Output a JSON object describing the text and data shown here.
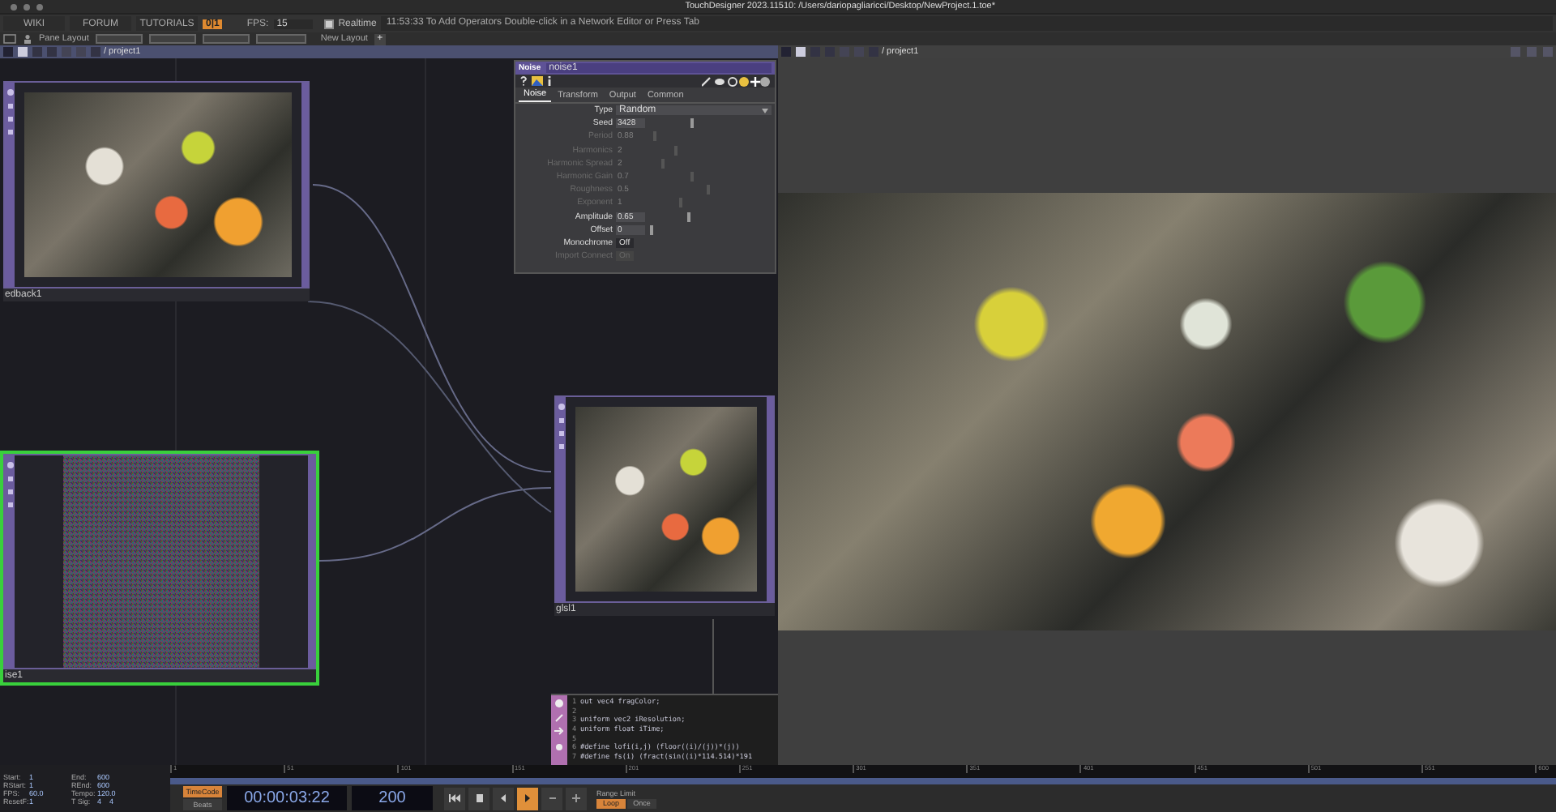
{
  "window": {
    "title": "TouchDesigner 2023.11510: /Users/dariopagliaricci/Desktop/NewProject.1.toe*"
  },
  "menu_bar": {
    "links": [
      "WIKI",
      "FORUM",
      "TUTORIALS"
    ],
    "counter": "0|1",
    "fps_label": "FPS:",
    "fps": "15",
    "realtime": {
      "label": "Realtime",
      "checked": true
    },
    "message": "11:53:33 To Add Operators Double-click in a Network Editor or Press Tab"
  },
  "layout_bar": {
    "pane_layout": "Pane Layout",
    "new_layout": "New Layout",
    "add": "+"
  },
  "left_pane": {
    "path": "/ project1",
    "nodes": [
      {
        "label": "edback1",
        "kind": "render",
        "selected": false
      },
      {
        "label": "ise1",
        "kind": "noise",
        "selected": true
      },
      {
        "label": "glsl1",
        "kind": "render",
        "selected": false
      }
    ],
    "params": {
      "op_type": "Noise",
      "name": "noise1",
      "tabs": [
        {
          "label": "Noise",
          "selected": true
        },
        {
          "label": "Transform",
          "selected": false
        },
        {
          "label": "Output",
          "selected": false
        },
        {
          "label": "Common",
          "selected": false
        }
      ],
      "rows": [
        {
          "label": "Type",
          "kind": "menu",
          "value": "Random",
          "disabled": false
        },
        {
          "label": "Seed",
          "kind": "slider",
          "value": "3428",
          "level": 0.35,
          "disabled": false
        },
        {
          "label": "Period",
          "kind": "slider",
          "value": "0.88",
          "level": 0.04,
          "disabled": true
        },
        {
          "label": "Harmonics",
          "kind": "slider",
          "value": "2",
          "level": 0.21,
          "disabled": true
        },
        {
          "label": "Harmonic Spread",
          "kind": "slider",
          "value": "2",
          "level": 0.11,
          "disabled": true
        },
        {
          "label": "Harmonic Gain",
          "kind": "slider",
          "value": "0.7",
          "level": 0.35,
          "disabled": true
        },
        {
          "label": "Roughness",
          "kind": "slider",
          "value": "0.5",
          "level": 0.49,
          "disabled": true
        },
        {
          "label": "Exponent",
          "kind": "slider",
          "value": "1",
          "level": 0.26,
          "disabled": true
        },
        {
          "label": "Amplitude",
          "kind": "slider",
          "value": "0.65",
          "level": 0.32,
          "disabled": false
        },
        {
          "label": "Offset",
          "kind": "slider",
          "value": "0",
          "level": 0.02,
          "disabled": false
        },
        {
          "label": "Monochrome",
          "kind": "toggle",
          "value": "Off",
          "disabled": false
        },
        {
          "label": "Import Connect",
          "kind": "toggle",
          "value": "On",
          "disabled": true
        }
      ]
    },
    "code": {
      "lines": [
        {
          "number": "1",
          "text": "out vec4 fragColor;"
        },
        {
          "number": "2"
        },
        {
          "number": "3",
          "text": "uniform vec2 iResolution;"
        },
        {
          "number": "4",
          "text": "uniform float iTime;"
        },
        {
          "number": "5"
        },
        {
          "number": "6",
          "text": "#define lofi(i,j) (floor((i)/(j))*(j))"
        },
        {
          "number": "7",
          "text": "#define fs(i) (fract(sin((i)*114.514)*191"
        }
      ]
    }
  },
  "right_pane": {
    "path": "/ project1"
  },
  "timeline": {
    "fields": [
      {
        "label": "Start:",
        "value": "1"
      },
      {
        "label": "End:",
        "value": "600"
      },
      {
        "label": "RStart:",
        "value": "1"
      },
      {
        "label": "REnd:",
        "value": "600"
      },
      {
        "label": "FPS:",
        "value": "60.0"
      },
      {
        "label": "Tempo:",
        "value": "120.0"
      },
      {
        "label": "ResetF:",
        "value": "1"
      },
      {
        "label": "T Sig:",
        "value": "4    4"
      }
    ],
    "ruler": [
      "1",
      "51",
      "101",
      "151",
      "201",
      "251",
      "301",
      "351",
      "401",
      "451",
      "501",
      "551",
      "600"
    ],
    "time_modes": [
      {
        "label": "TimeCode",
        "selected": true
      },
      {
        "label": "Beats",
        "selected": false
      }
    ],
    "timecode": "00:00:03:22",
    "frame": "200",
    "transport": [
      {
        "kind": "start",
        "selected": false
      },
      {
        "kind": "stop",
        "selected": false
      },
      {
        "kind": "reverse",
        "selected": false
      },
      {
        "kind": "play",
        "selected": true
      },
      {
        "kind": "step-back",
        "selected": false
      },
      {
        "kind": "step-forward",
        "selected": false
      }
    ],
    "range_limit": {
      "label": "Range Limit",
      "options": [
        {
          "label": "Loop",
          "selected": true
        },
        {
          "label": "Once",
          "selected": false
        }
      ]
    }
  }
}
